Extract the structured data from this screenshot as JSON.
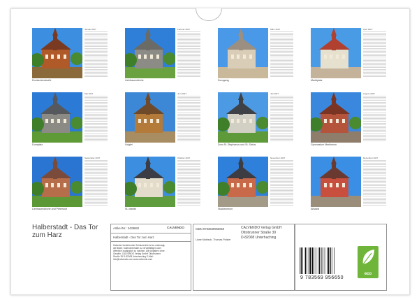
{
  "months": [
    {
      "name": "Januar 2027",
      "caption": "Domkurienstraße"
    },
    {
      "name": "Februar 2027",
      "caption": "Liebfrauenkirche"
    },
    {
      "name": "März 2027",
      "caption": "Domgang"
    },
    {
      "name": "April 2027",
      "caption": "Marktplatz"
    },
    {
      "name": "Mai 2027",
      "caption": "Domplatz"
    },
    {
      "name": "Juni 2027",
      "caption": "Voigtei"
    },
    {
      "name": "Juli 2027",
      "caption": "Dom St. Stephanus und St. Sixtus"
    },
    {
      "name": "August 2027",
      "caption": "Gymnasium Martineum"
    },
    {
      "name": "September 2027",
      "caption": "Liebfrauenkirche und Petershof"
    },
    {
      "name": "Oktober 2027",
      "caption": "St. Martini"
    },
    {
      "name": "November 2027",
      "caption": "Stadtzentrum"
    },
    {
      "name": "Dezember 2027",
      "caption": "Altstadt"
    }
  ],
  "footer": {
    "title": "Halberstadt - Das Tor zum Harz",
    "article": "Artikel-Nr.: 2438683",
    "calvendo_logo": "CALVENDO",
    "subtitle": "Halberstadt - Das Tor zum Harz",
    "description": "Kalender bestehender Schutzrechte ist es untersagt, die Bilder, Kalenderinhalte zu vervielfältigen oder öffentlich zugänglich zu machen. Alle Angaben ohne Gewähr. CALVENDO Verlag GmbH Ottobrunner Straße 39 D-82008 Unterhaching E-Mail: info@calvendo.com www.calvendo.com",
    "isbn": "ISBN 9783569956650",
    "authors": "Liane Matrisch, Thomas Polster",
    "publisher_name": "CALVENDO Verlag GmbH",
    "publisher_street": "Ottobrunner Straße 39",
    "publisher_city": "D-82008 Unterhaching",
    "barcode_number": "9 783569 956650",
    "eco_label": "eco"
  }
}
